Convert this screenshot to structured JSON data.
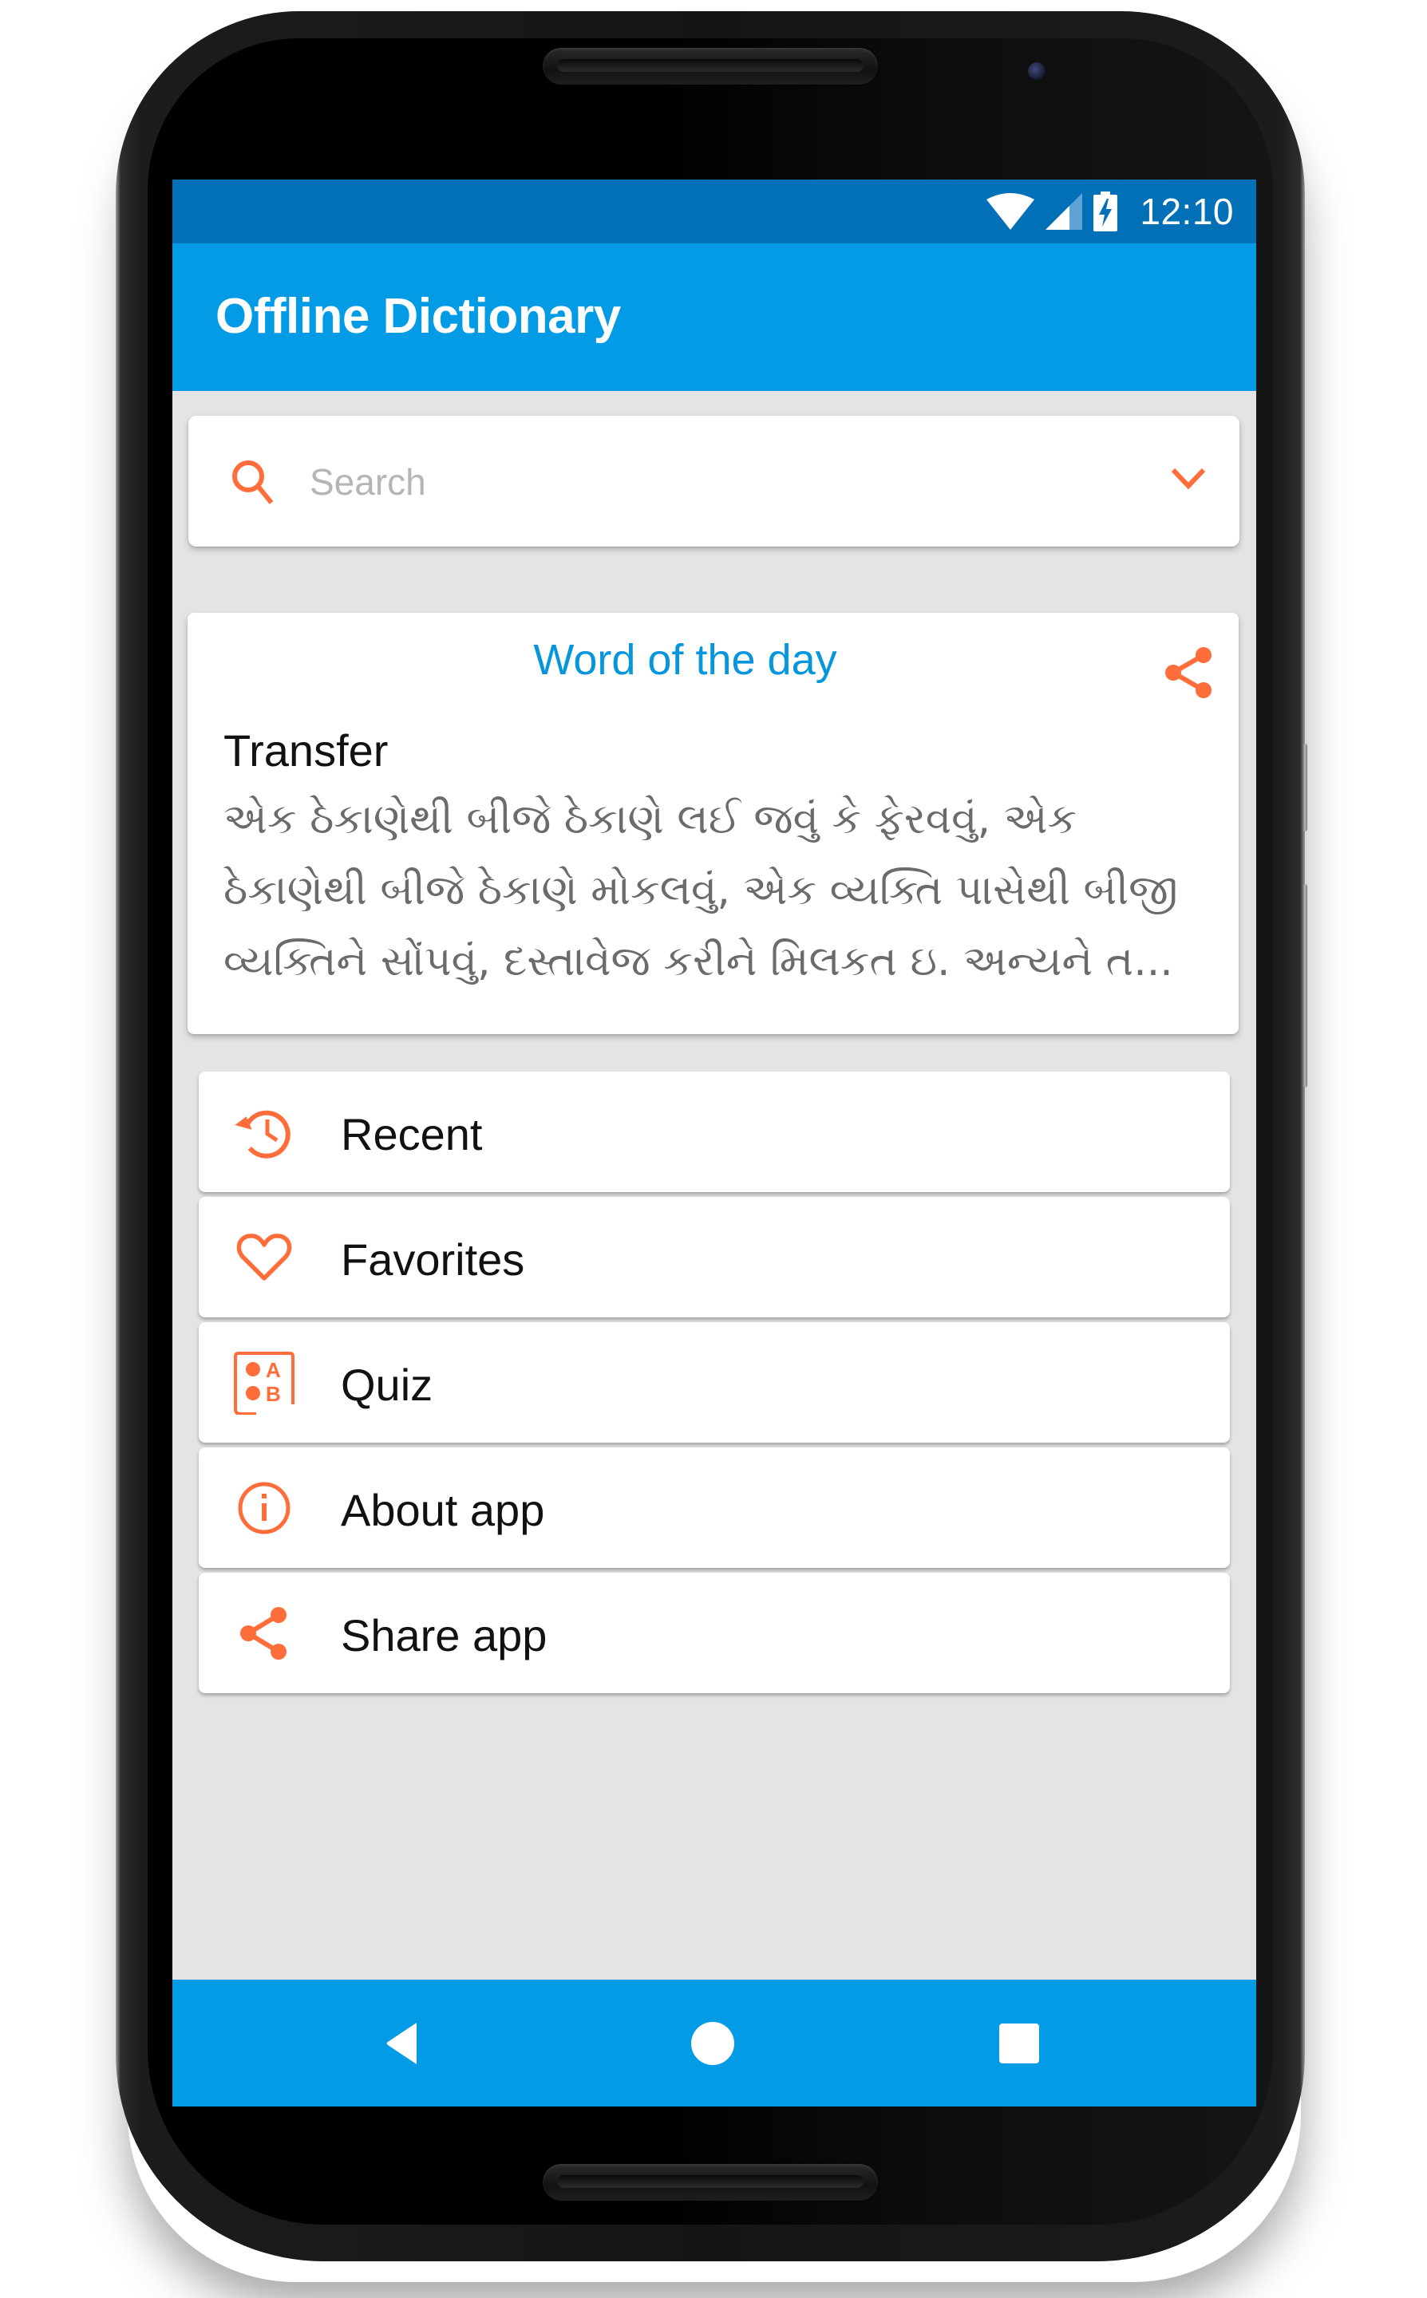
{
  "status_bar": {
    "time": "12:10",
    "icons": [
      "wifi-icon",
      "cell-signal-icon",
      "battery-charging-icon"
    ]
  },
  "app_bar": {
    "title": "Offline Dictionary"
  },
  "search": {
    "placeholder": "Search",
    "value": "",
    "icon": "search-icon",
    "dropdown_icon": "chevron-down-icon"
  },
  "word_of_the_day": {
    "title": "Word of the day",
    "word": "Transfer",
    "meaning": "એક ઠેકાણેથી બીજે ઠેકાણે લઈ જવું કે ફેરવવું, એક ઠેકાણેથી બીજે ઠેકાણે મોકલવું, એક વ્યક્તિ પાસેથી બીજી વ્યક્તિને સોંપવું, દસ્તાવેજ કરીને મિલકત ઇ. અન્યને ત...",
    "share_icon": "share-icon"
  },
  "menu": {
    "items": [
      {
        "label": "Recent",
        "icon": "history-icon"
      },
      {
        "label": "Favorites",
        "icon": "heart-icon"
      },
      {
        "label": "Quiz",
        "icon": "quiz-ab-icon"
      },
      {
        "label": "About app",
        "icon": "info-icon"
      },
      {
        "label": "Share app",
        "icon": "share-icon"
      }
    ]
  },
  "nav_bar": {
    "buttons": [
      "back",
      "home",
      "recents"
    ]
  },
  "colors": {
    "status_bar": "#0270b7",
    "app_bar": "#039be5",
    "accent": "#ff6d3a",
    "wotd_title": "#0596dd",
    "background": "#e4e4e4"
  }
}
